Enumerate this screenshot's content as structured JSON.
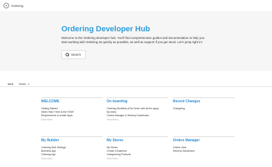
{
  "topbar": {
    "app_name": "Ordering"
  },
  "hero": {
    "title": "Ordering Developer Hub",
    "description": "Welcome to the Ordering developer hub. You'll find comprehensive guides and documentation to help you start working with Ordering as quickly as possible, as well as support if you get stuck. Let's jump right in!",
    "search_label": "Search"
  },
  "nav": {
    "brand": "v4.0",
    "home": "Home"
  },
  "cards": [
    {
      "title": "WELCOME",
      "links": [
        "Getting Started",
        "Need Help? Here is the HOW!",
        "Requirements to create Apps"
      ],
      "more": "View More..."
    },
    {
      "title": "On boarding",
      "links": [
        "Ordering Workflow (One Order with all the apps)",
        "My video",
        "Orders Manager & Delivery Dashboard"
      ],
      "more": "View More..."
    },
    {
      "title": "Recent Changes",
      "links": [
        "Changelog"
      ],
      "more": ""
    },
    {
      "title": "My Builder",
      "links": [
        "Ordering Web Settings",
        "Business App",
        "Ordering App"
      ],
      "more": "View More..."
    },
    {
      "title": "My Stores",
      "links": [
        "My Stores",
        "Create a Business",
        "Categorizing Products"
      ],
      "more": "View More..."
    },
    {
      "title": "Orders Manager",
      "links": [
        "Orders View",
        "Delivery Dashboard"
      ],
      "more": ""
    }
  ]
}
